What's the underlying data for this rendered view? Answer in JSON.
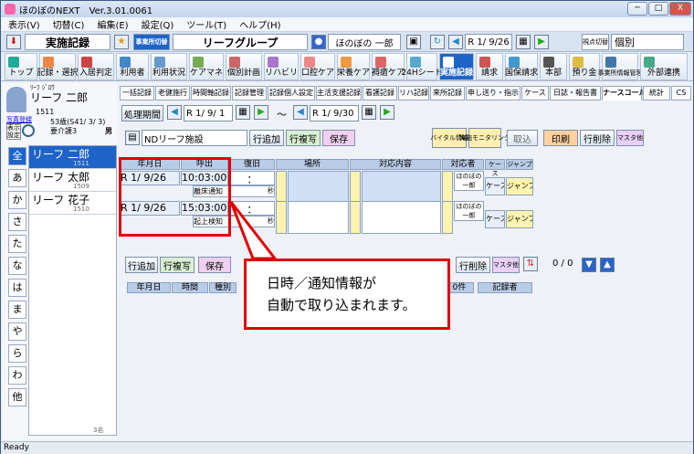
{
  "window": {
    "title": "ほのぼのNEXT　Ver.3.01.0061",
    "min": "─",
    "max": "□",
    "close": "X"
  },
  "menu": [
    "表示(V)",
    "切替(C)",
    "編集(E)",
    "設定(Q)",
    "ツール(T)",
    "ヘルプ(H)"
  ],
  "header": {
    "screen": "実施記録",
    "office_switch": "事業所切替",
    "group": "リーフグループ",
    "user": "ほのぼの 一郎",
    "date": "R 1/ 9/26",
    "view_switch": "視点切替",
    "view_mode": "個別"
  },
  "toolbar": [
    "トップ",
    "記録・選択",
    "入居判定",
    "利用者",
    "利用状況",
    "ケアマネ",
    "個別計画",
    "リハビリ",
    "口腔ケア",
    "栄養ケア",
    "褥瘡ケア",
    "24Hシート",
    "実施記録",
    "請求",
    "国保請求",
    "本部",
    "預り金",
    "事業所情報管理",
    "外部連携"
  ],
  "client": {
    "furigana": "ﾘｰﾌ ｼﾞﾛｳ",
    "name": "リーフ 二郎",
    "id": "1511",
    "birth": "53歳(S41/ 3/ 3)",
    "care": "要介護3",
    "sex": "男",
    "photo_label": "写真登録",
    "display_label": "表示",
    "settings_label": "設定"
  },
  "kana": [
    "全",
    "あ",
    "か",
    "さ",
    "た",
    "な",
    "は",
    "ま",
    "や",
    "ら",
    "わ",
    "他"
  ],
  "list": [
    {
      "name": "リーフ 二郎",
      "id": "1511"
    },
    {
      "name": "リーフ 太郎",
      "id": "1509"
    },
    {
      "name": "リーフ 花子",
      "id": "1510"
    }
  ],
  "list_count": "3名",
  "tabs": [
    "一括記録",
    "老健施行",
    "時間軸記録",
    "記録管理",
    "記録個人設定",
    "主活支援記録",
    "看護記録",
    "リハ記録",
    "来所記録",
    "申し送り・指示",
    "ケース",
    "日誌・報告書",
    "ナースコール",
    "統計",
    "CS"
  ],
  "period": {
    "label": "処理期間",
    "from": "R 1/ 9/ 1",
    "to": "R 1/ 9/30",
    "tilde": "～"
  },
  "facility": "NDリーフ施設",
  "buttons": {
    "row_add": "行追加",
    "row_copy": "行複写",
    "save": "保存",
    "vital": "バイタル情報",
    "monitor": "実施モニタリング",
    "cancel": "取込",
    "print": "印刷",
    "row_delete": "行削除",
    "master": "マスタ他"
  },
  "grid": {
    "headers": [
      "年月日",
      "呼出",
      "復旧",
      "場所",
      "対応内容",
      "対応者",
      "ケース",
      "ジャンプ"
    ],
    "rows": [
      {
        "date": "R 1/ 9/26",
        "time": "10:03:00",
        "type": "離床通知",
        "recover": "：",
        "sec": "秒",
        "staff": "ほのぼの 一郎",
        "case": "ケース",
        "jump": "ジャンプ"
      },
      {
        "date": "R 1/ 9/26",
        "time": "15:03:00",
        "type": "起上検知",
        "recover": "：",
        "sec": "秒",
        "staff": "ほのぼの 一郎",
        "case": "ケース",
        "jump": "ジャンプ"
      }
    ]
  },
  "counter": "0 / 0",
  "lower_headers": [
    "年月日",
    "時間",
    "種別",
    "0件",
    "記録者"
  ],
  "callout": [
    "日時／通知情報が",
    "自動で取り込まれます。"
  ],
  "status": "Ready"
}
